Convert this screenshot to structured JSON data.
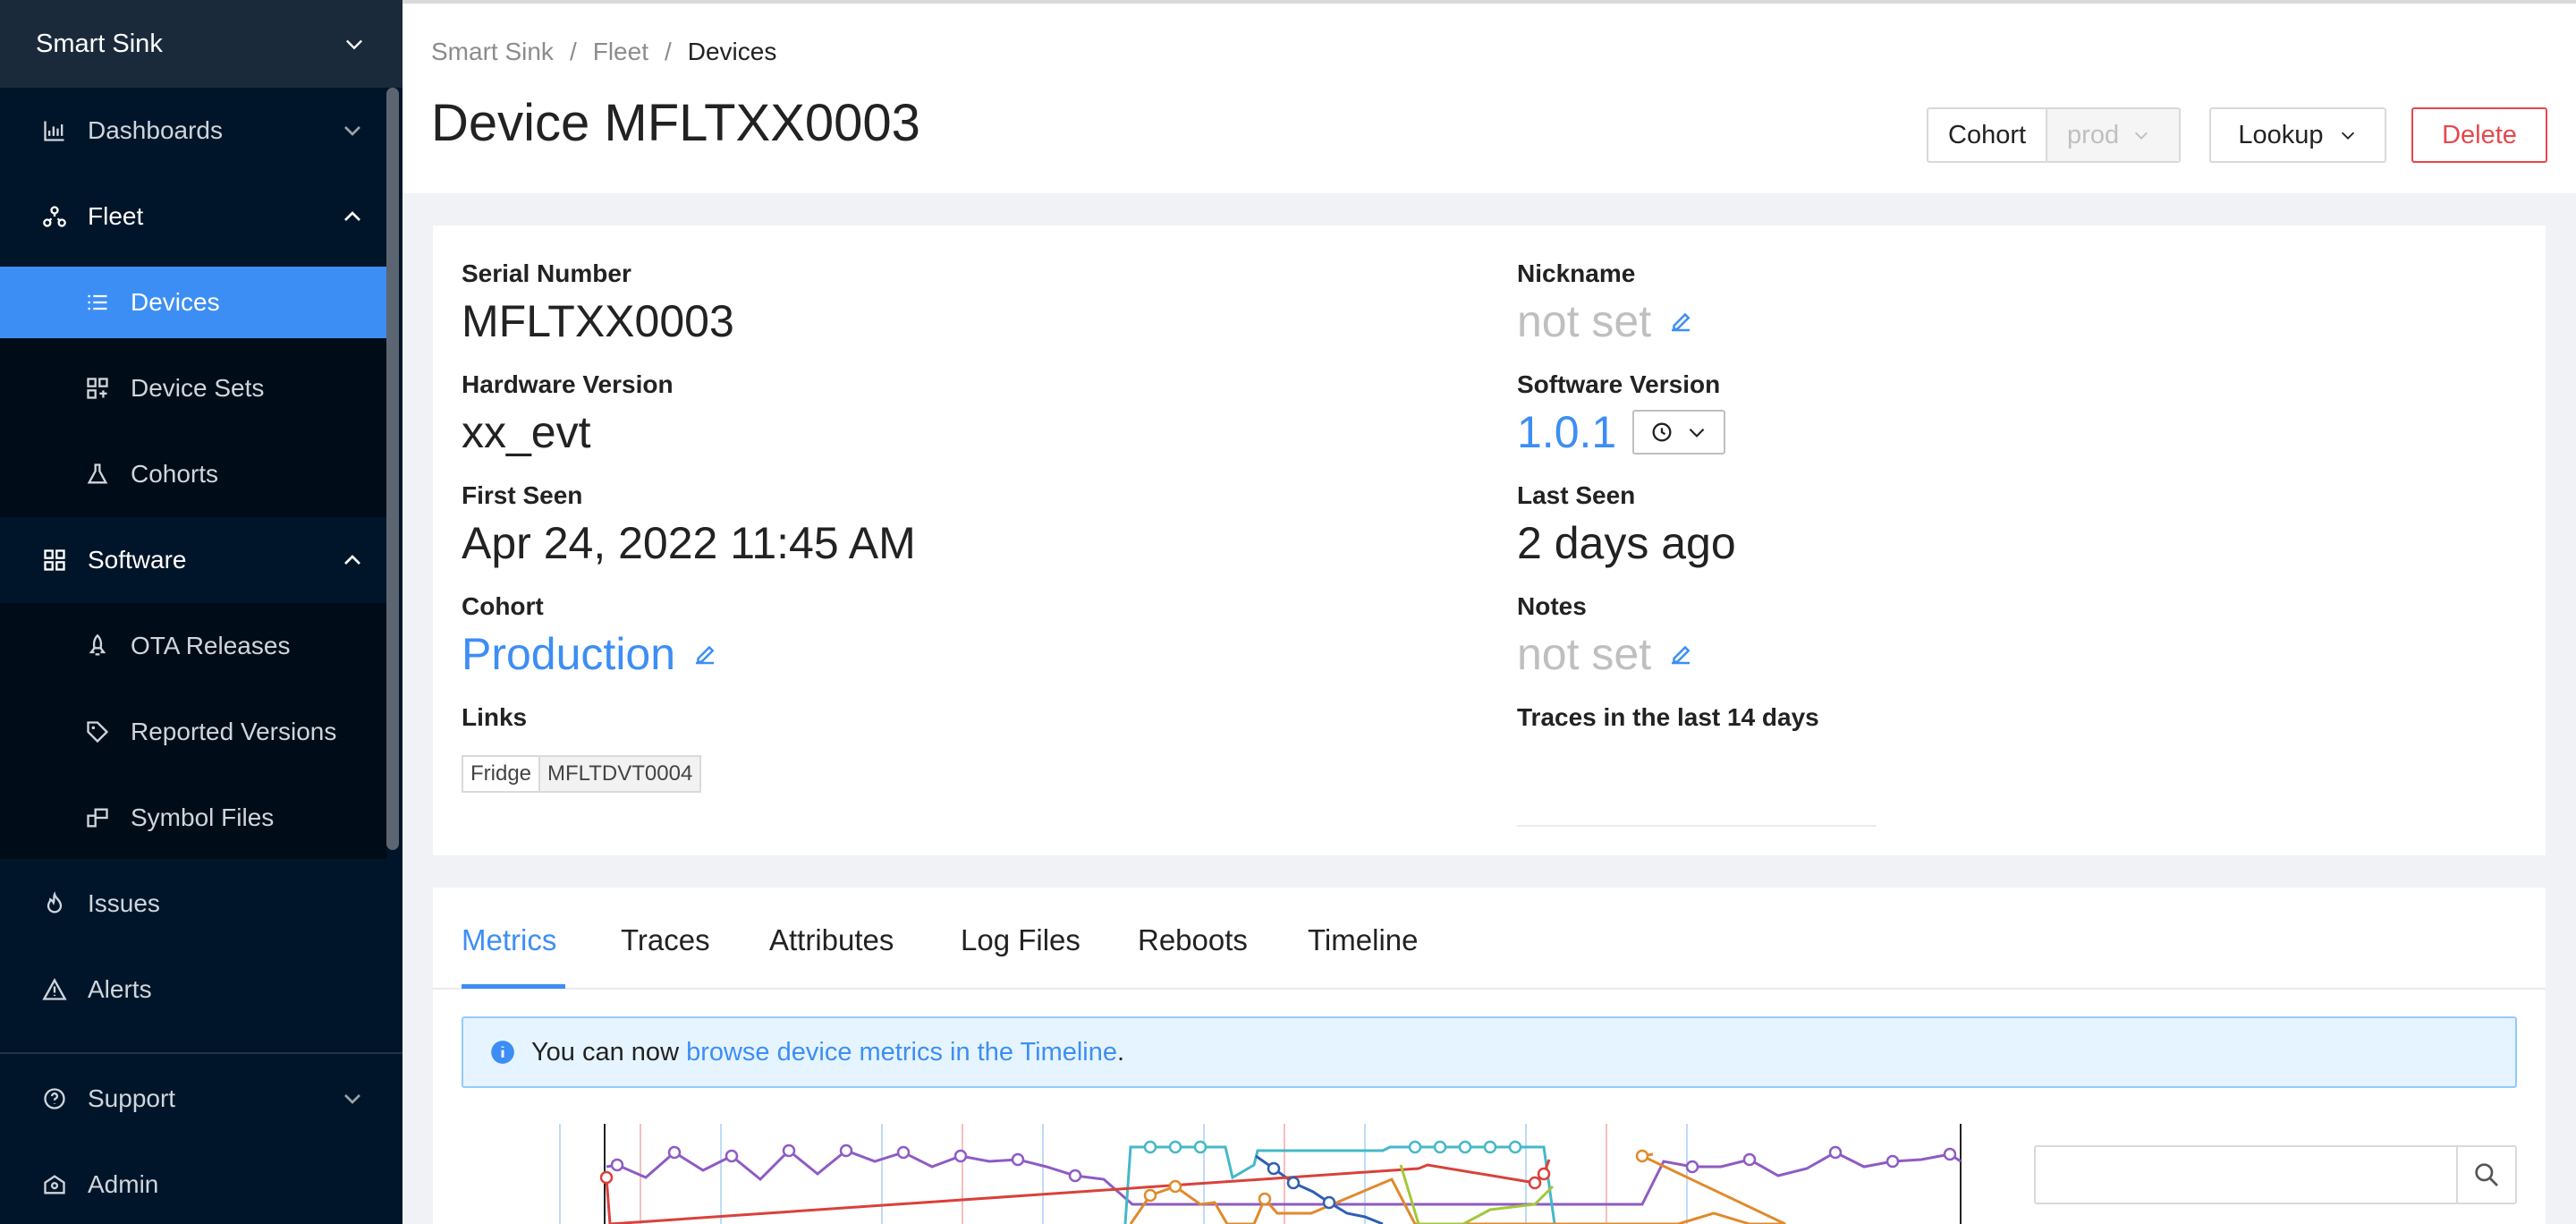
{
  "sidebar": {
    "org": "Smart Sink",
    "items": [
      {
        "label": "Dashboards",
        "icon": "bar-chart-icon"
      },
      {
        "label": "Fleet",
        "icon": "fleet-icon"
      },
      {
        "label": "Devices",
        "icon": "list-icon"
      },
      {
        "label": "Device Sets",
        "icon": "device-sets-icon"
      },
      {
        "label": "Cohorts",
        "icon": "flask-icon"
      },
      {
        "label": "Software",
        "icon": "grid-icon"
      },
      {
        "label": "OTA Releases",
        "icon": "rocket-icon"
      },
      {
        "label": "Reported Versions",
        "icon": "tag-icon"
      },
      {
        "label": "Symbol Files",
        "icon": "symbol-icon"
      },
      {
        "label": "Issues",
        "icon": "flame-icon"
      },
      {
        "label": "Alerts",
        "icon": "alert-icon"
      },
      {
        "label": "Support",
        "icon": "help-icon"
      },
      {
        "label": "Admin",
        "icon": "admin-icon"
      }
    ]
  },
  "breadcrumb": [
    "Smart Sink",
    "/",
    "Fleet",
    "/",
    "Devices"
  ],
  "header": {
    "title": "Device MFLTXX0003",
    "cohort_label": "Cohort",
    "cohort_value": "prod",
    "lookup_label": "Lookup",
    "delete_label": "Delete"
  },
  "device": {
    "serial_label": "Serial Number",
    "serial_value": "MFLTXX0003",
    "hw_label": "Hardware Version",
    "hw_value": "xx_evt",
    "first_seen_label": "First Seen",
    "first_seen_value": "Apr 24, 2022 11:45 AM",
    "cohort_label": "Cohort",
    "cohort_value": "Production",
    "links_label": "Links",
    "link_tag_key": "Fridge",
    "link_tag_value": "MFLTDVT0004",
    "nickname_label": "Nickname",
    "nickname_value": "not set",
    "sw_label": "Software Version",
    "sw_value": "1.0.1",
    "last_seen_label": "Last Seen",
    "last_seen_value": "2 days ago",
    "notes_label": "Notes",
    "notes_value": "not set",
    "traces_label": "Traces in the last 14 days"
  },
  "tabs": [
    "Metrics",
    "Traces",
    "Attributes",
    "Log Files",
    "Reboots",
    "Timeline"
  ],
  "alert": {
    "prefix": "You can now",
    "link": "browse device metrics in the Timeline",
    "suffix": "."
  },
  "colors": {
    "accent": "#3d8ef4",
    "sidebar_bg": "#001529",
    "danger": "#e5484d"
  }
}
